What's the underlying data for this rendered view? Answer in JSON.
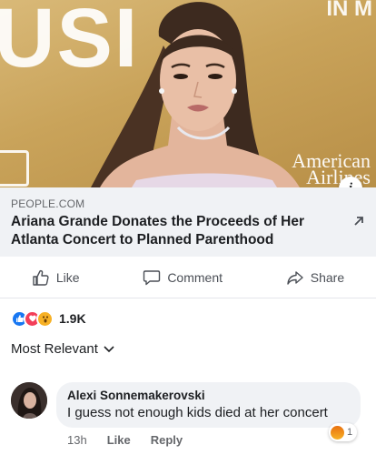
{
  "hero": {
    "backdrop_text": "USI",
    "backdrop_text_right": "IN M",
    "sponsor_text_line1": "American",
    "sponsor_text_line2": "Airlines",
    "info_badge": "i"
  },
  "link": {
    "source": "PEOPLE.COM",
    "title": "Ariana Grande Donates the Proceeds of Her Atlanta Concert to Planned Parenthood"
  },
  "actions": {
    "like": "Like",
    "comment": "Comment",
    "share": "Share"
  },
  "reactions": {
    "types": [
      "like",
      "love",
      "wow"
    ],
    "count": "1.9K"
  },
  "sort": {
    "label": "Most Relevant"
  },
  "comment": {
    "author": "Alexi Sonnemakerovski",
    "text": "I guess not enough kids died at her concert",
    "time": "13h",
    "like": "Like",
    "reply": "Reply",
    "reaction_count": "1",
    "reaction_type": "angry"
  },
  "colors": {
    "accent": "#1877f2",
    "bubble": "#f0f2f5",
    "muted_text": "#65676b"
  }
}
